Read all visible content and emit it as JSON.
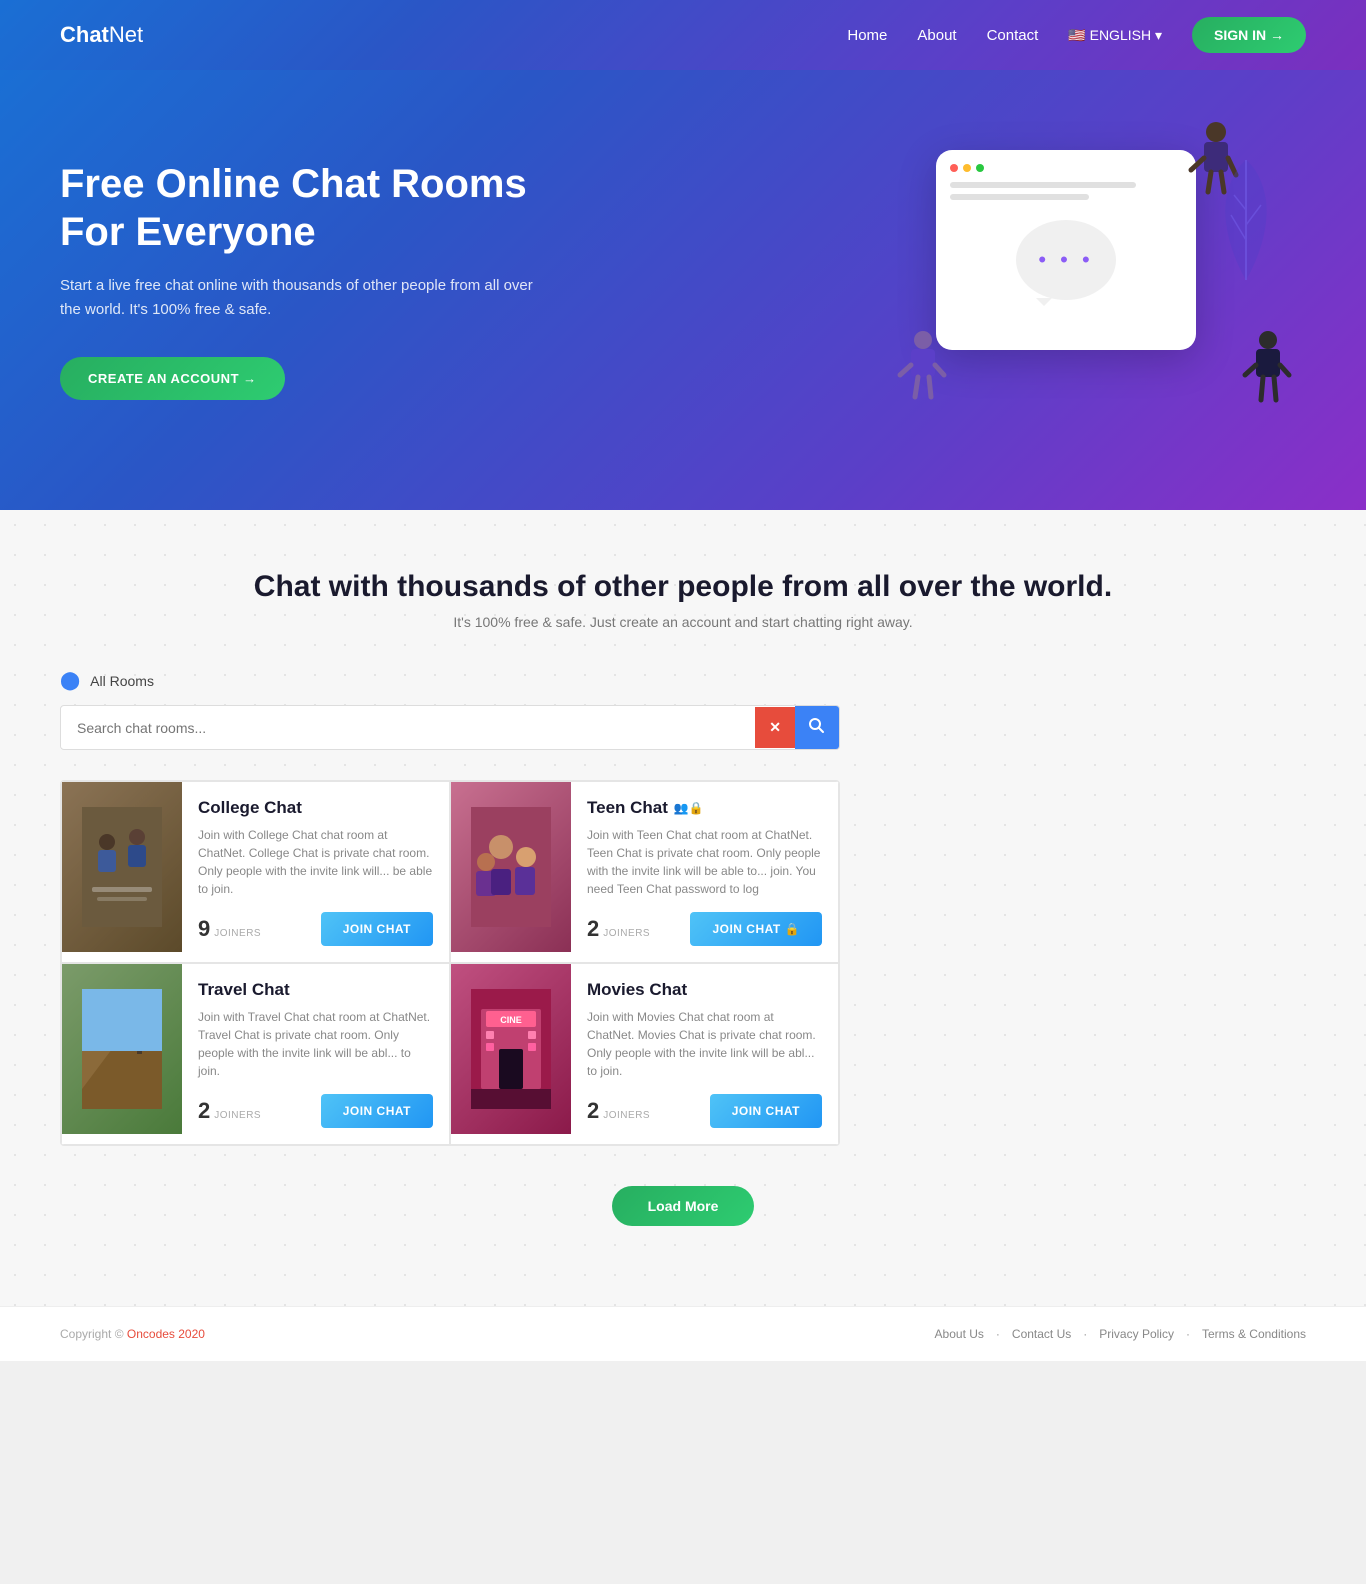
{
  "header": {
    "logo_bold": "Chat",
    "logo_light": "Net",
    "nav": [
      {
        "label": "Home",
        "href": "#"
      },
      {
        "label": "About",
        "href": "#"
      },
      {
        "label": "Contact",
        "href": "#"
      },
      {
        "label": "🇺🇸 ENGLISH ▾",
        "href": "#"
      }
    ],
    "sign_in": "SIGN IN →"
  },
  "hero": {
    "title": "Free Online Chat Rooms For Everyone",
    "subtitle": "Start a live free chat online with thousands of other people from all over the world. It's 100% free & safe.",
    "cta": "CREATE AN ACCOUNT →"
  },
  "main": {
    "title": "Chat with thousands of other people from all over the world.",
    "subtitle": "It's 100% free &amp; safe. Just create an account and start chatting right away.",
    "filter_label": "All Rooms",
    "search_placeholder": "Search chat rooms...",
    "search_clear": "✕",
    "search_go": "🔍",
    "rooms": [
      {
        "id": "college-chat",
        "title": "College Chat",
        "private": false,
        "desc": "Join with College Chat chat room at ChatNet. College Chat is private chat room. Only people with the invite link will... be able to join.",
        "joiners": "9",
        "joiners_label": "JOINERS",
        "join_label": "JOIN CHAT",
        "color_top": "#8B7355",
        "color_bottom": "#5C4A2A"
      },
      {
        "id": "teen-chat",
        "title": "Teen Chat",
        "private": true,
        "desc": "Join with Teen Chat chat room at ChatNet. Teen Chat is private chat room. Only people with the invite link will be able to... join. You need Teen Chat password to log",
        "joiners": "2",
        "joiners_label": "JOINERS",
        "join_label": "JOIN CHAT 🔒",
        "color_top": "#D4A0A0",
        "color_bottom": "#B07070"
      },
      {
        "id": "travel-chat",
        "title": "Travel Chat",
        "private": false,
        "desc": "Join with Travel Chat chat room at ChatNet. Travel Chat is private chat room. Only people with the invite link will be abl... to join.",
        "joiners": "2",
        "joiners_label": "JOINERS",
        "join_label": "JOIN CHAT",
        "color_top": "#7B9B6A",
        "color_bottom": "#4A7A3A"
      },
      {
        "id": "movies-chat",
        "title": "Movies Chat",
        "private": false,
        "desc": "Join with Movies Chat chat room at ChatNet. Movies Chat is private chat room. Only people with the invite link will be abl... to join.",
        "joiners": "2",
        "joiners_label": "JOINERS",
        "join_label": "JOIN CHAT",
        "color_top": "#C05080",
        "color_bottom": "#8B1A4A"
      }
    ],
    "load_more": "Load More"
  },
  "footer": {
    "copyright": "Copyright ©",
    "brand": "Oncodes 2020",
    "links": [
      {
        "label": "About Us"
      },
      {
        "label": "Contact Us"
      },
      {
        "label": "Privacy Policy"
      },
      {
        "label": "Terms & Conditions"
      }
    ]
  }
}
